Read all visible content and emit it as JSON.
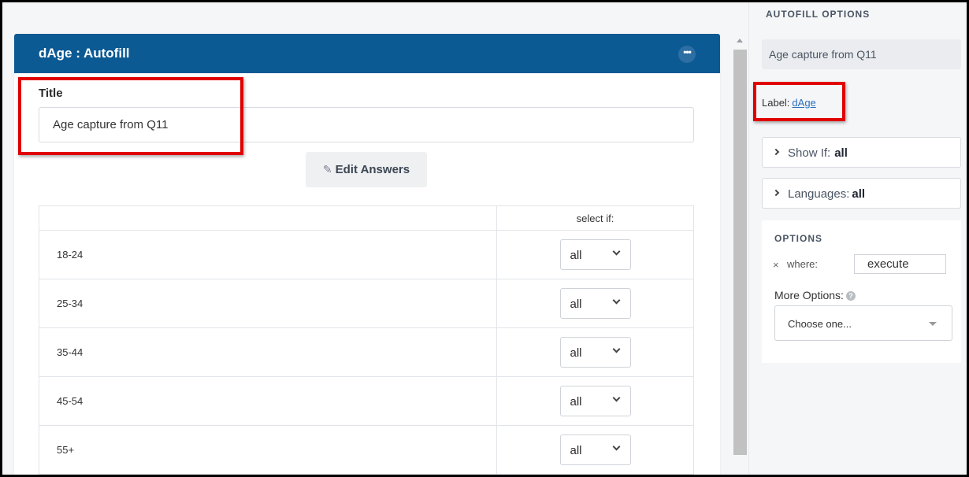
{
  "panel": {
    "title": "dAge : Autofill",
    "more_label": "•••",
    "title_field_label": "Title",
    "title_value": "Age capture from Q11",
    "edit_answers_label": "Edit Answers",
    "pencil_icon": "✎",
    "table": {
      "headers": [
        "",
        "select if:"
      ],
      "rows": [
        {
          "label": "18-24",
          "value": "all"
        },
        {
          "label": "25-34",
          "value": "all"
        },
        {
          "label": "35-44",
          "value": "all"
        },
        {
          "label": "45-54",
          "value": "all"
        },
        {
          "label": "55+",
          "value": "all"
        }
      ]
    }
  },
  "sidebar": {
    "heading": "AUTOFILL OPTIONS",
    "description": "Age capture from Q11",
    "label_prefix": "Label:",
    "label_value": "dAge",
    "show_if": {
      "label": "Show If:",
      "value": "all"
    },
    "languages": {
      "label": "Languages:",
      "value": "all"
    },
    "options": {
      "heading": "OPTIONS",
      "remove": "×",
      "where_label": "where:",
      "where_value": "execute",
      "more_options_label": "More Options:",
      "help": "?",
      "choose_placeholder": "Choose one..."
    }
  },
  "colors": {
    "header_blue": "#0c5a93",
    "highlight_red": "#e00000",
    "link_blue": "#2a6fbd"
  }
}
